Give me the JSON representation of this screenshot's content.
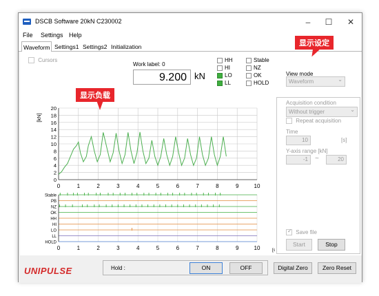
{
  "window": {
    "title": "DSCB Software   20kN  C230002",
    "controls": [
      "–",
      "☐",
      "✕"
    ]
  },
  "menu": [
    "File",
    "Settings",
    "Help"
  ],
  "tabs": [
    "Waveform",
    "Settings1",
    "Settings2",
    "Initialization"
  ],
  "waveform": {
    "cursors_label": "Cursors",
    "work_label": "Work label: 0",
    "value": "9.200",
    "unit": "kN",
    "flags_col1": [
      {
        "label": "HH",
        "on": false
      },
      {
        "label": "HI",
        "on": false
      },
      {
        "label": "LO",
        "on": true
      },
      {
        "label": "LL",
        "on": true
      }
    ],
    "flags_col2": [
      {
        "label": "Stable",
        "on": false
      },
      {
        "label": "NZ",
        "on": false
      },
      {
        "label": "OK",
        "on": false
      },
      {
        "label": "HOLD",
        "on": false
      }
    ]
  },
  "right_panel": {
    "view_mode_label": "View mode",
    "view_mode_value": "Waveform",
    "acquisition_condition_label": "Acquisition condition",
    "acquisition_condition_value": "Without trigger",
    "repeat_acquisition": "Repeat acquisition",
    "time_label": "Time",
    "time_value": "10",
    "time_unit": "[s]",
    "yaxis_label": "Y-axis range [kN]",
    "yaxis_min": "-1",
    "yaxis_sep": "~",
    "yaxis_max": "20",
    "save_file": "Save file",
    "start": "Start",
    "stop": "Stop"
  },
  "footer": {
    "logo": "UNIPULSE",
    "hold_label": "Hold :",
    "on": "ON",
    "off": "OFF",
    "digital_zero": "Digital Zero",
    "zero_reset": "Zero Reset"
  },
  "callouts": {
    "display_settings": "显示设定",
    "display_load": "显示负载"
  },
  "chart_data": [
    {
      "type": "line",
      "ylabel": "[kN]",
      "xlim": [
        0,
        10
      ],
      "ylim": [
        0,
        20
      ],
      "x_ticks": [
        "0",
        "1",
        "2",
        "3",
        "4",
        "5",
        "6",
        "7",
        "8",
        "9",
        "10"
      ],
      "y_ticks": [
        "0",
        "2",
        "4",
        "6",
        "8",
        "10",
        "12",
        "14",
        "16",
        "18",
        "20"
      ],
      "grid": true,
      "color": "#4caf50",
      "series": [
        {
          "x": [
            0,
            0.15,
            0.3,
            0.45,
            0.6,
            0.75,
            0.9,
            1.0,
            1.1,
            1.25,
            1.4,
            1.5,
            1.65,
            1.8,
            1.95,
            2.1,
            2.25,
            2.45,
            2.6,
            2.75,
            2.9,
            3.05,
            3.2,
            3.35,
            3.5,
            3.65,
            3.8,
            3.95,
            4.1,
            4.25,
            4.4,
            4.55,
            4.7,
            4.85,
            5.0,
            5.15,
            5.3,
            5.45,
            5.6,
            5.75,
            5.9,
            6.05,
            6.2,
            6.35,
            6.5,
            6.65,
            6.8,
            6.95,
            7.1,
            7.25,
            7.4,
            7.55,
            7.7,
            7.85,
            8.0,
            8.15,
            8.3,
            8.45
          ],
          "y": [
            1.5,
            2.2,
            3.5,
            4.5,
            6.5,
            8.5,
            9.5,
            10.5,
            7.5,
            5.0,
            6.5,
            9.5,
            12.0,
            8.0,
            5.0,
            7.0,
            13.2,
            8.5,
            5.0,
            7.5,
            13.0,
            8.0,
            4.5,
            7.0,
            13.2,
            8.0,
            4.5,
            7.5,
            13.3,
            8.0,
            4.5,
            6.0,
            11.0,
            6.5,
            4.0,
            6.5,
            11.5,
            7.0,
            4.0,
            6.5,
            12.0,
            7.5,
            4.0,
            6.0,
            11.5,
            7.0,
            4.0,
            6.0,
            12.0,
            7.0,
            4.0,
            6.0,
            12.0,
            7.0,
            4.0,
            6.5,
            12.0,
            6.5
          ]
        }
      ]
    },
    {
      "type": "line",
      "xlabel": "[s]",
      "xlim": [
        0,
        10
      ],
      "x_ticks": [
        "0",
        "1",
        "2",
        "3",
        "4",
        "5",
        "6",
        "7",
        "8",
        "9",
        "10"
      ],
      "y_categories": [
        "Stable",
        "PB",
        "NZ",
        "OK",
        "HH",
        "HI",
        "LO",
        "LL",
        "HOLD"
      ],
      "grid": true,
      "series": [
        {
          "name": "Stable",
          "color": "#3fae3f",
          "marks": [
            0.08,
            0.45,
            0.75,
            0.95,
            1.3,
            1.5,
            1.9,
            2.1,
            2.5,
            2.75,
            3.1,
            3.35,
            3.7,
            3.95,
            4.3,
            4.55,
            4.9,
            5.15,
            5.5,
            5.75,
            6.1,
            6.35,
            6.7,
            6.95,
            7.3,
            7.55,
            7.9,
            8.15
          ]
        },
        {
          "name": "PB",
          "color": "#e08a3a",
          "marks": []
        },
        {
          "name": "NZ",
          "color": "#3fae3f",
          "marks": [
            0.05,
            0.35,
            0.7,
            1.2,
            1.45,
            1.8,
            2.05,
            2.4,
            2.7,
            3.0,
            3.3,
            3.6,
            3.9,
            4.2,
            4.5,
            4.8,
            5.1,
            5.4,
            5.7,
            6.0,
            6.3,
            6.6,
            6.9,
            7.2,
            7.5,
            7.8,
            8.1
          ]
        },
        {
          "name": "OK",
          "color": "#3fae3f",
          "marks": []
        },
        {
          "name": "HH",
          "color": "#e08a3a",
          "marks": []
        },
        {
          "name": "HI",
          "color": "#e08a3a",
          "marks": []
        },
        {
          "name": "LO",
          "color": "#e08a3a",
          "marks": [
            3.7
          ]
        },
        {
          "name": "LL",
          "color": "#7a6bb8",
          "marks": []
        },
        {
          "name": "HOLD",
          "color": "#4a7acc",
          "marks": []
        }
      ]
    }
  ]
}
